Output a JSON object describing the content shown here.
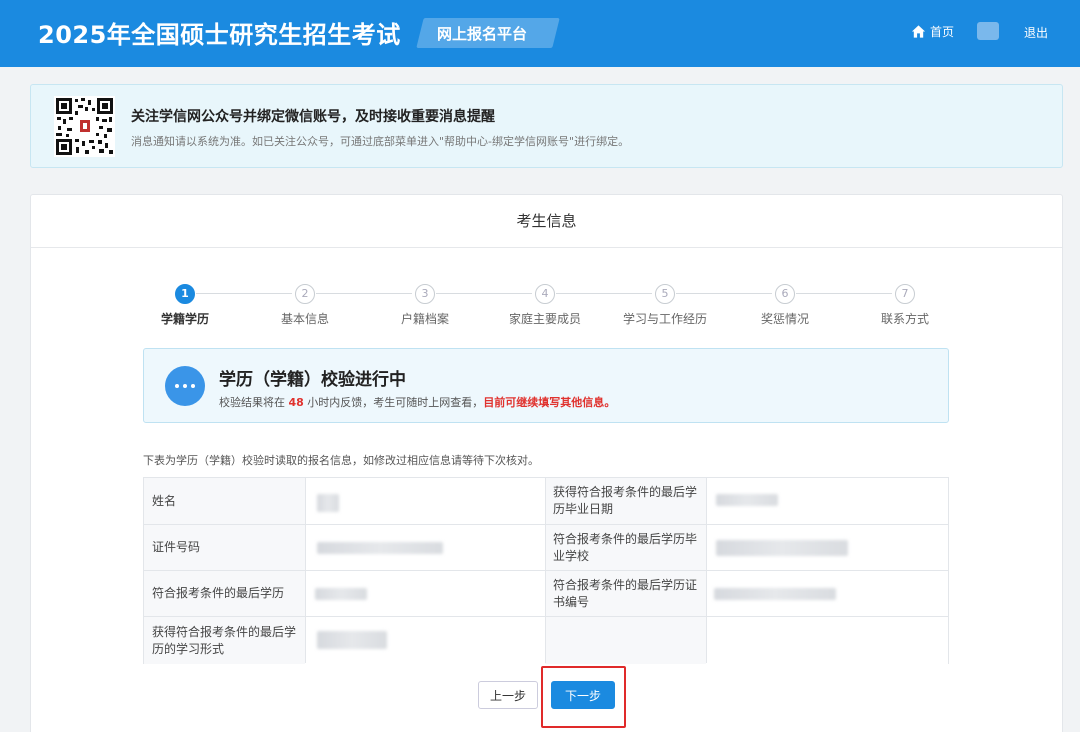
{
  "header": {
    "title": "2025年全国硕士研究生招生考试",
    "platform": "网上报名平台",
    "home_label": "首页",
    "logout_label": "退出",
    "icons": {
      "home": "home-icon",
      "avatar": "user-avatar"
    },
    "colors": {
      "bar": "#1b8ae0"
    }
  },
  "notice": {
    "title": "关注学信网公众号并绑定微信账号，及时接收重要消息提醒",
    "subtitle": "消息通知请以系统为准。如已关注公众号，可通过底部菜单进入\"帮助中心-绑定学信网账号\"进行绑定。",
    "qr_icon": "qr-code"
  },
  "panel": {
    "title": "考生信息"
  },
  "steps": [
    {
      "num": "1",
      "label": "学籍学历",
      "active": true
    },
    {
      "num": "2",
      "label": "基本信息",
      "active": false
    },
    {
      "num": "3",
      "label": "户籍档案",
      "active": false
    },
    {
      "num": "4",
      "label": "家庭主要成员",
      "active": false
    },
    {
      "num": "5",
      "label": "学习与工作经历",
      "active": false
    },
    {
      "num": "6",
      "label": "奖惩情况",
      "active": false
    },
    {
      "num": "7",
      "label": "联系方式",
      "active": false
    }
  ],
  "status": {
    "title": "学历（学籍）校验进行中",
    "sub_prefix": "校验结果将在 ",
    "hours": "48",
    "sub_mid": " 小时内反馈，考生可随时上网查看，",
    "sub_red": "目前可继续填写其他信息",
    "sub_end": "。",
    "icon": "more-dots-icon",
    "accent": "#e0322e"
  },
  "table_desc": "下表为学历（学籍）校验时读取的报名信息，如修改过相应信息请等待下次核对。",
  "table": {
    "rows": [
      {
        "l1": "姓名",
        "l2": "获得符合报考条件的最后学历毕业日期"
      },
      {
        "l1": "证件号码",
        "l2": "符合报考条件的最后学历毕业学校"
      },
      {
        "l1": "符合报考条件的最后学历",
        "l2": "符合报考条件的最后学历证书编号"
      },
      {
        "l1": "获得符合报考条件的最后学历的学习形式",
        "l2": ""
      }
    ]
  },
  "buttons": {
    "prev": "上一步",
    "next": "下一步"
  }
}
